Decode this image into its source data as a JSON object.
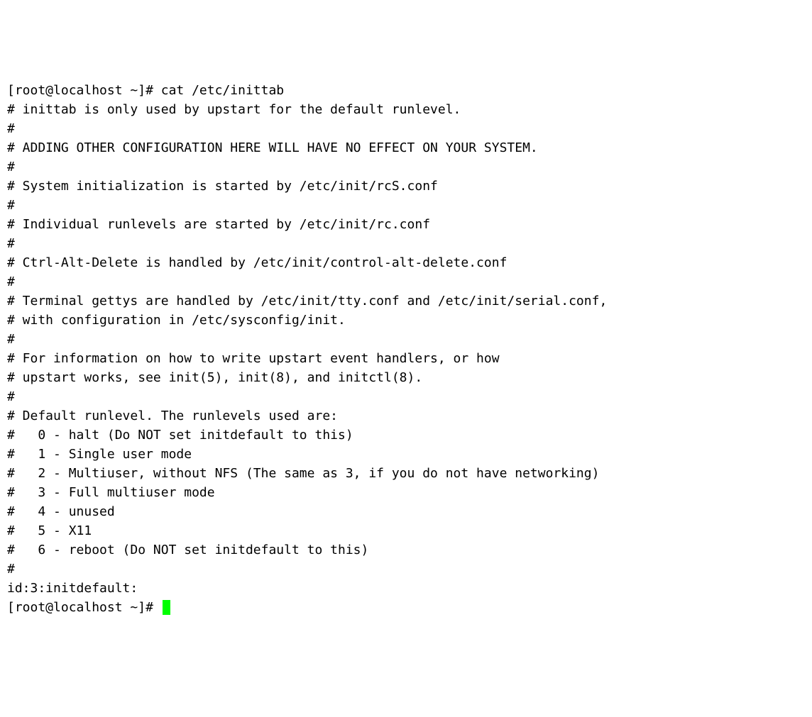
{
  "terminal": {
    "prompt1": "[root@localhost ~]# ",
    "command": "cat /etc/inittab",
    "output_lines": [
      "# inittab is only used by upstart for the default runlevel.",
      "#",
      "# ADDING OTHER CONFIGURATION HERE WILL HAVE NO EFFECT ON YOUR SYSTEM.",
      "#",
      "# System initialization is started by /etc/init/rcS.conf",
      "#",
      "# Individual runlevels are started by /etc/init/rc.conf",
      "#",
      "# Ctrl-Alt-Delete is handled by /etc/init/control-alt-delete.conf",
      "#",
      "# Terminal gettys are handled by /etc/init/tty.conf and /etc/init/serial.conf,",
      "# with configuration in /etc/sysconfig/init.",
      "#",
      "# For information on how to write upstart event handlers, or how",
      "# upstart works, see init(5), init(8), and initctl(8).",
      "#",
      "# Default runlevel. The runlevels used are:",
      "#   0 - halt (Do NOT set initdefault to this)",
      "#   1 - Single user mode",
      "#   2 - Multiuser, without NFS (The same as 3, if you do not have networking)",
      "#   3 - Full multiuser mode",
      "#   4 - unused",
      "#   5 - X11",
      "#   6 - reboot (Do NOT set initdefault to this)",
      "#",
      "id:3:initdefault:"
    ],
    "prompt2": "[root@localhost ~]# "
  },
  "cursor_color": "#00ff00"
}
